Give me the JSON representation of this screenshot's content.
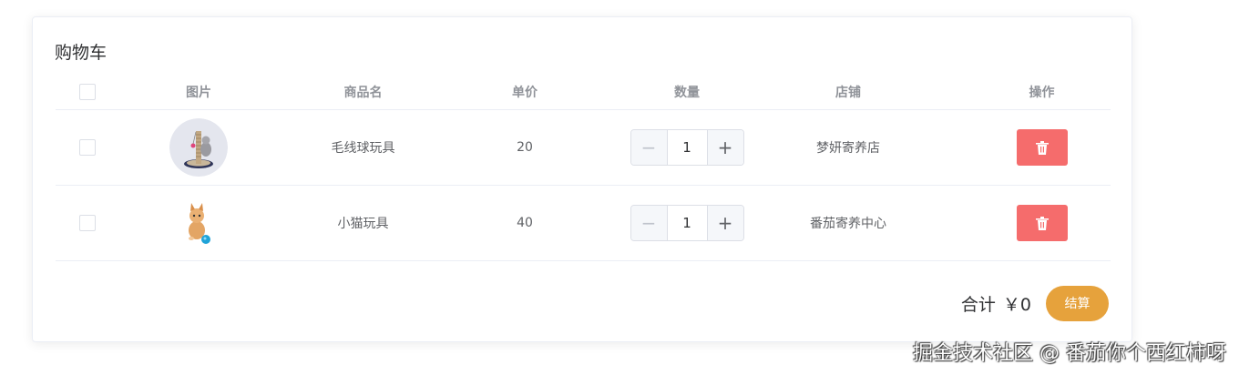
{
  "cart": {
    "title": "购物车",
    "columns": {
      "image": "图片",
      "name": "商品名",
      "price": "单价",
      "quantity": "数量",
      "shop": "店铺",
      "action": "操作"
    },
    "items": [
      {
        "name": "毛线球玩具",
        "price": "20",
        "quantity": "1",
        "shop": "梦妍寄养店",
        "image_icon": "cat-tree-toy-photo"
      },
      {
        "name": "小猫玩具",
        "price": "40",
        "quantity": "1",
        "shop": "番茄寄养中心",
        "image_icon": "kitten-with-ball-photo"
      }
    ],
    "total_label": "合计",
    "total_value": "￥0",
    "checkout_label": "结算",
    "minus_symbol": "−",
    "plus_symbol": "+"
  },
  "colors": {
    "delete_button": "#f56c6c",
    "checkout_button": "#e6a23c"
  },
  "watermark": "掘金技术社区 @ 番茄你个西红柿呀"
}
